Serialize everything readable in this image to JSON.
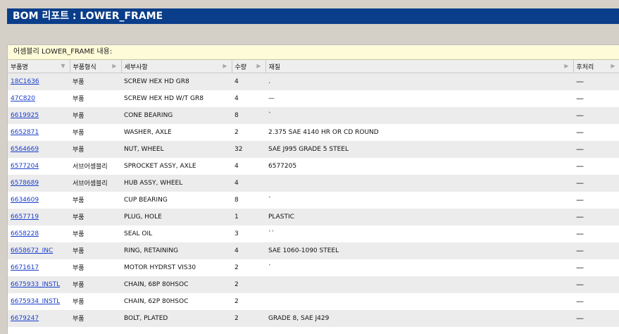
{
  "title": "BOM 리포트 : LOWER_FRAME",
  "caption": "어셈블리 LOWER_FRAME 내용:",
  "columns": [
    {
      "label": "부품명",
      "arrow": "▼"
    },
    {
      "label": "부품형식",
      "arrow": "▶"
    },
    {
      "label": "세부사항",
      "arrow": "▶"
    },
    {
      "label": "수량",
      "arrow": "▶"
    },
    {
      "label": "재질",
      "arrow": "▶"
    },
    {
      "label": "후처리",
      "arrow": "▶"
    }
  ],
  "rows": [
    {
      "part": "18C1636",
      "type": "부품",
      "desc": "SCREW HEX HD GR8",
      "qty": "4",
      "material": ".",
      "post": "—"
    },
    {
      "part": "47C820",
      "type": "부품",
      "desc": "SCREW HEX HD W/T GR8",
      "qty": "4",
      "material": "—",
      "post": "—"
    },
    {
      "part": "6619925",
      "type": "부품",
      "desc": "CONE BEARING",
      "qty": "8",
      "material": "`",
      "post": "—"
    },
    {
      "part": "6652871",
      "type": "부품",
      "desc": "WASHER, AXLE",
      "qty": "2",
      "material": "2.375 SAE 4140 HR OR CD ROUND",
      "post": "—"
    },
    {
      "part": "6564669",
      "type": "부품",
      "desc": "NUT, WHEEL",
      "qty": "32",
      "material": "SAE J995 GRADE 5 STEEL",
      "post": "—"
    },
    {
      "part": "6577204",
      "type": "서브어셈블리",
      "desc": "SPROCKET ASSY, AXLE",
      "qty": "4",
      "material": "6577205",
      "post": "—"
    },
    {
      "part": "6578689",
      "type": "서브어셈블리",
      "desc": "HUB ASSY, WHEEL",
      "qty": "4",
      "material": "",
      "post": "—"
    },
    {
      "part": "6634609",
      "type": "부품",
      "desc": "CUP BEARING",
      "qty": "8",
      "material": "`",
      "post": "—"
    },
    {
      "part": "6657719",
      "type": "부품",
      "desc": "PLUG, HOLE",
      "qty": "1",
      "material": "PLASTIC",
      "post": "—"
    },
    {
      "part": "6658228",
      "type": "부품",
      "desc": "SEAL OIL",
      "qty": "3",
      "material": "``",
      "post": "—"
    },
    {
      "part": "6658672_INC",
      "type": "부품",
      "desc": "RING, RETAINING",
      "qty": "4",
      "material": "SAE 1060-1090 STEEL",
      "post": "—"
    },
    {
      "part": "6671617",
      "type": "부품",
      "desc": "MOTOR HYDRST VIS30",
      "qty": "2",
      "material": "`",
      "post": "—"
    },
    {
      "part": "6675933_INSTL",
      "type": "부품",
      "desc": "CHAIN, 68P 80HSOC",
      "qty": "2",
      "material": "",
      "post": "—"
    },
    {
      "part": "6675934_INSTL",
      "type": "부품",
      "desc": "CHAIN, 62P 80HSOC",
      "qty": "2",
      "material": "",
      "post": "—"
    },
    {
      "part": "6679247",
      "type": "부품",
      "desc": "BOLT, PLATED",
      "qty": "2",
      "material": "GRADE 8, SAE J429",
      "post": "—"
    }
  ]
}
